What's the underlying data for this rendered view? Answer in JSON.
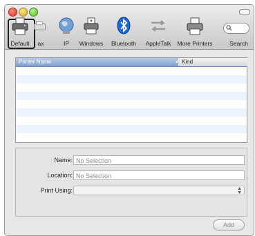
{
  "toolbar": {
    "items": [
      {
        "label": "Default",
        "icon": "printer-icon"
      },
      {
        "label": "Fax",
        "display": "ax",
        "icon": "fax-icon"
      },
      {
        "label": "IP",
        "icon": "globe-icon"
      },
      {
        "label": "Windows",
        "icon": "windows-printer-icon"
      },
      {
        "label": "Bluetooth",
        "icon": "bluetooth-icon"
      },
      {
        "label": "AppleTalk",
        "icon": "appletalk-icon"
      },
      {
        "label": "More Printers",
        "icon": "printer-icon"
      }
    ],
    "search_label": "Search"
  },
  "list": {
    "columns": {
      "name": "Printer Name",
      "kind": "Kind"
    },
    "sort_indicator": "▲"
  },
  "form": {
    "name_label": "Name:",
    "name_value": "No Selection",
    "location_label": "Location:",
    "location_value": "No Selection",
    "print_using_label": "Print Using:"
  },
  "buttons": {
    "add": "Add"
  },
  "colors": {
    "header_blue": "#7ea0d0",
    "row_alt": "#edf3fe",
    "window_bg": "#e8e8e8"
  }
}
